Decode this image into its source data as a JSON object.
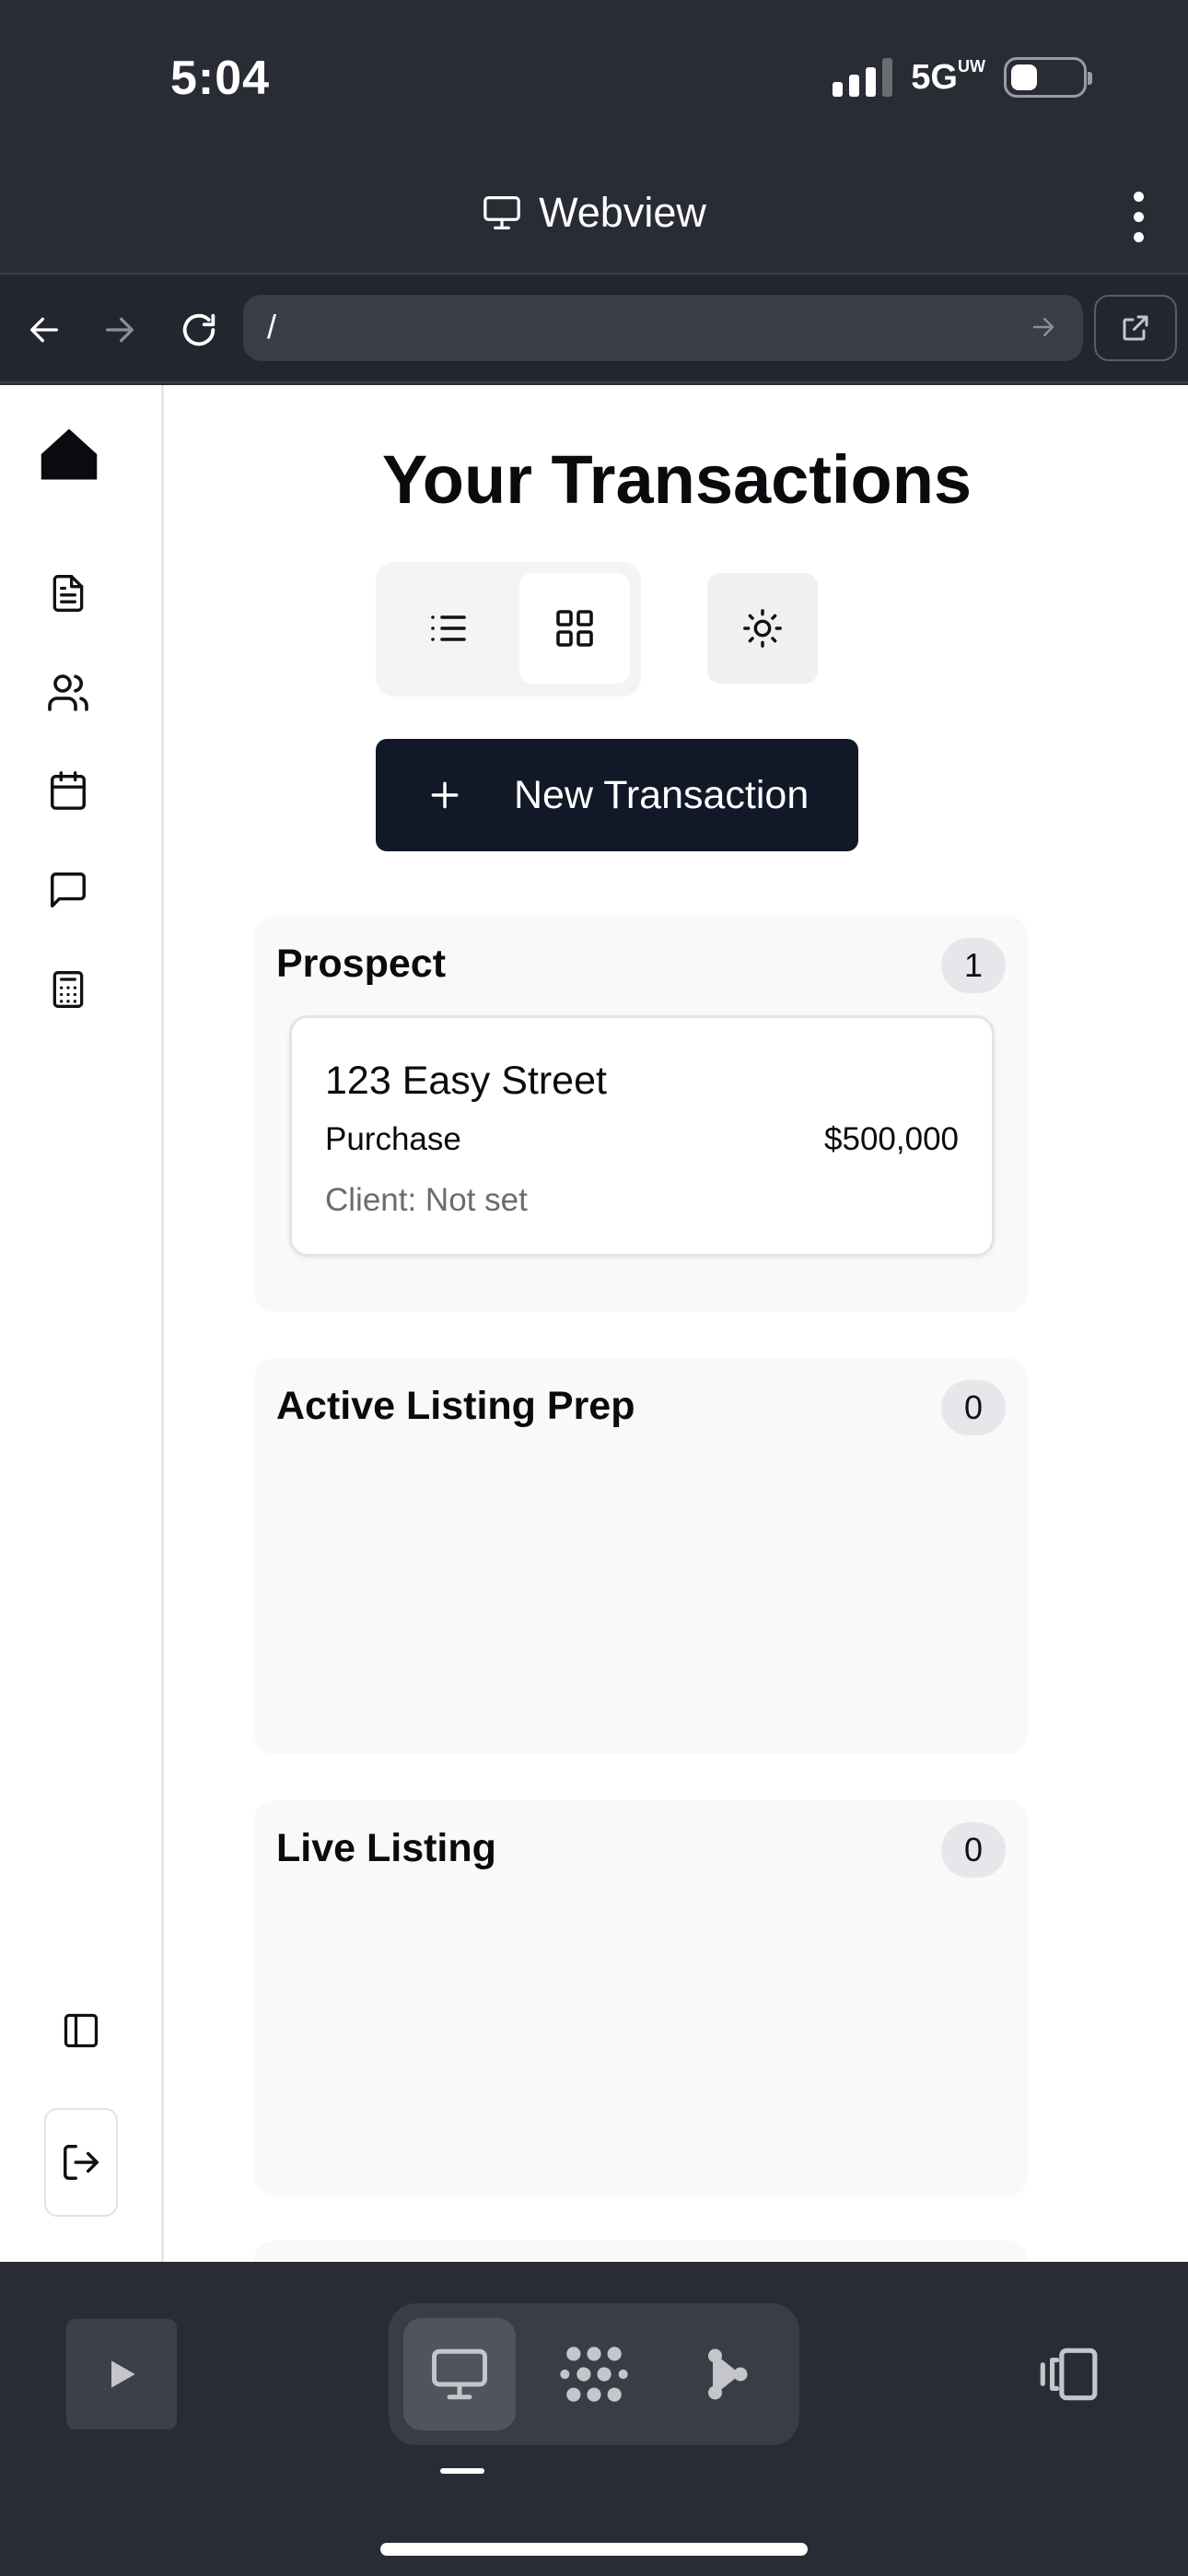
{
  "status_bar": {
    "time": "5:04",
    "network": "5G",
    "network_sup": "UW"
  },
  "webview_header": {
    "title": "Webview"
  },
  "url_bar": {
    "url": "/"
  },
  "page": {
    "title": "Your Transactions",
    "new_button_label": "New Transaction",
    "columns": [
      {
        "title": "Prospect",
        "count": "1",
        "cards": [
          {
            "address": "123 Easy Street",
            "type": "Purchase",
            "price": "$500,000",
            "client": "Client: Not set"
          }
        ]
      },
      {
        "title": "Active Listing Prep",
        "count": "0",
        "cards": []
      },
      {
        "title": "Live Listing",
        "count": "0",
        "cards": []
      }
    ]
  },
  "sidebar": {
    "icons": [
      "home-icon",
      "document-icon",
      "users-icon",
      "calendar-icon",
      "message-icon",
      "calculator-icon",
      "panel-toggle-icon",
      "logout-icon"
    ]
  },
  "bottom_bar": {
    "icons": [
      "play-icon",
      "desktop-icon",
      "dots-icon",
      "share-icon",
      "rotate-device-icon"
    ]
  },
  "colors": {
    "chrome": "#292c35",
    "primary_button": "#111827",
    "column_bg": "#f9f9f8"
  }
}
